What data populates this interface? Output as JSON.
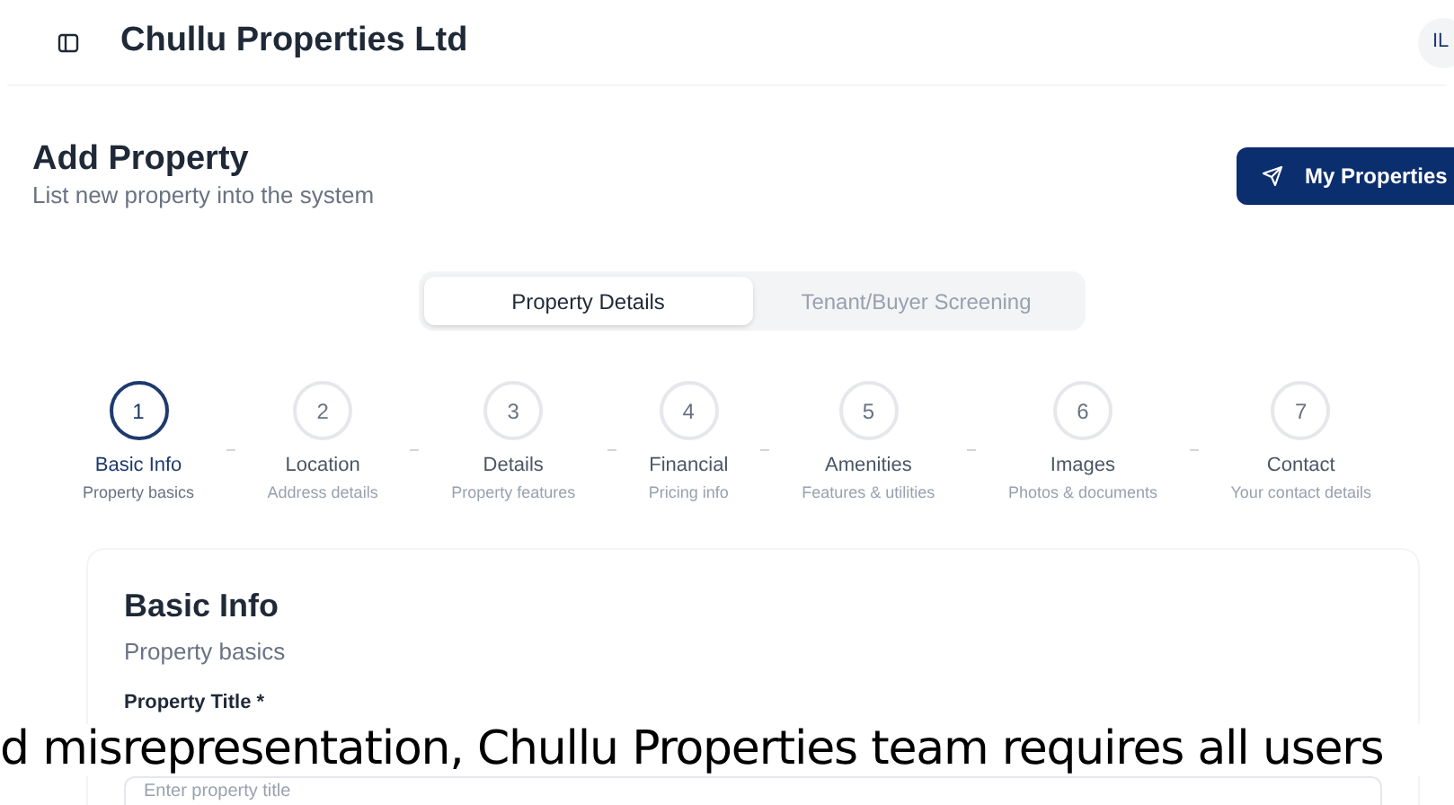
{
  "header": {
    "title": "Chullu Properties Ltd",
    "avatar": "IL"
  },
  "page": {
    "title": "Add Property",
    "subtitle": "List new property into the system",
    "action": "My Properties"
  },
  "tabs": [
    {
      "label": "Property Details",
      "selected": true
    },
    {
      "label": "Tenant/Buyer Screening",
      "selected": false
    }
  ],
  "steps": [
    {
      "number": "1",
      "title": "Basic Info",
      "subtitle": "Property basics",
      "selected": true
    },
    {
      "number": "2",
      "title": "Location",
      "subtitle": "Address details",
      "selected": false
    },
    {
      "number": "3",
      "title": "Details",
      "subtitle": "Property features",
      "selected": false
    },
    {
      "number": "4",
      "title": "Financial",
      "subtitle": "Pricing info",
      "selected": false
    },
    {
      "number": "5",
      "title": "Amenities",
      "subtitle": "Features & utilities",
      "selected": false
    },
    {
      "number": "6",
      "title": "Images",
      "subtitle": "Photos & documents",
      "selected": false
    },
    {
      "number": "7",
      "title": "Contact",
      "subtitle": "Your contact details",
      "selected": false
    }
  ],
  "card": {
    "title": "Basic Info",
    "subtitle": "Property basics",
    "field_label": "Property Title *",
    "placeholder": "Enter property title"
  },
  "overlay_text": "d misrepresentation, Chullu Properties team requires all users"
}
